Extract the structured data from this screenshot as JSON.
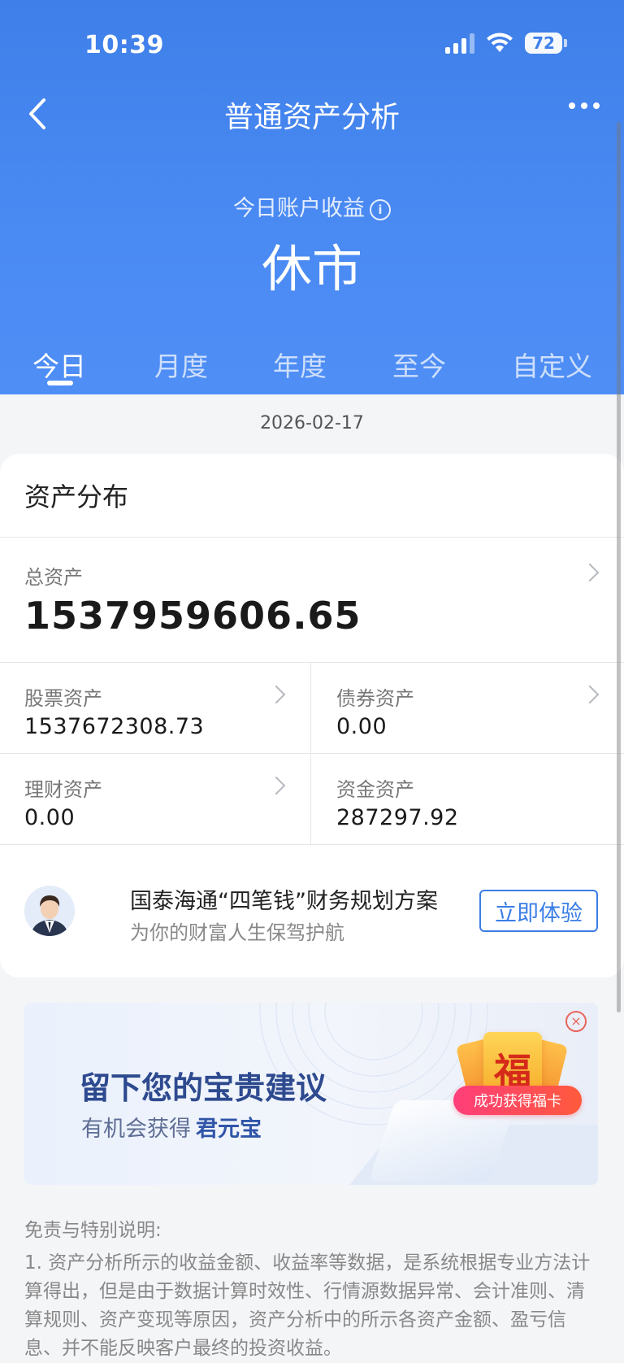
{
  "status_bar": {
    "time": "10:39",
    "battery": "72"
  },
  "nav": {
    "title": "普通资产分析"
  },
  "summary": {
    "income_label": "今日账户收益",
    "income_value": "休市"
  },
  "tabs": [
    {
      "label": "今日",
      "active": true
    },
    {
      "label": "月度",
      "active": false
    },
    {
      "label": "年度",
      "active": false
    },
    {
      "label": "至今",
      "active": false
    },
    {
      "label": "自定义",
      "active": false
    }
  ],
  "date": "2026-02-17",
  "assets": {
    "section_title": "资产分布",
    "total": {
      "label": "总资产",
      "value": "1537959606.65"
    },
    "stock": {
      "label": "股票资产",
      "value": "1537672308.73"
    },
    "bond": {
      "label": "债券资产",
      "value": "0.00"
    },
    "wealth": {
      "label": "理财资产",
      "value": "0.00"
    },
    "cash": {
      "label": "资金资产",
      "value": "287297.92"
    }
  },
  "promo": {
    "title": "国泰海通“四笔钱”财务规划方案",
    "subtitle": "为你的财富人生保驾护航",
    "button": "立即体验"
  },
  "banner": {
    "title": "留下您的宝贵建议",
    "subtitle_prefix": "有机会获得",
    "subtitle_highlight": "君元宝",
    "card_char": "福",
    "pill": "成功获得福卡"
  },
  "disclaimer": {
    "title": "免责与特别说明:",
    "text": "1. 资产分析所示的收益金额、收益率等数据，是系统根据专业方法计算得出，但是由于数据计算时效性、行情源数据异常、会计准则、清算规则、资产变现等原因，资产分析中的所示各资产金额、盈亏信息、并不能反映客户最终的投资收益。"
  },
  "colors": {
    "header_blue": "#4a8af3",
    "accent_blue": "#3a7de6",
    "pill_red": "#ff3e7a"
  }
}
